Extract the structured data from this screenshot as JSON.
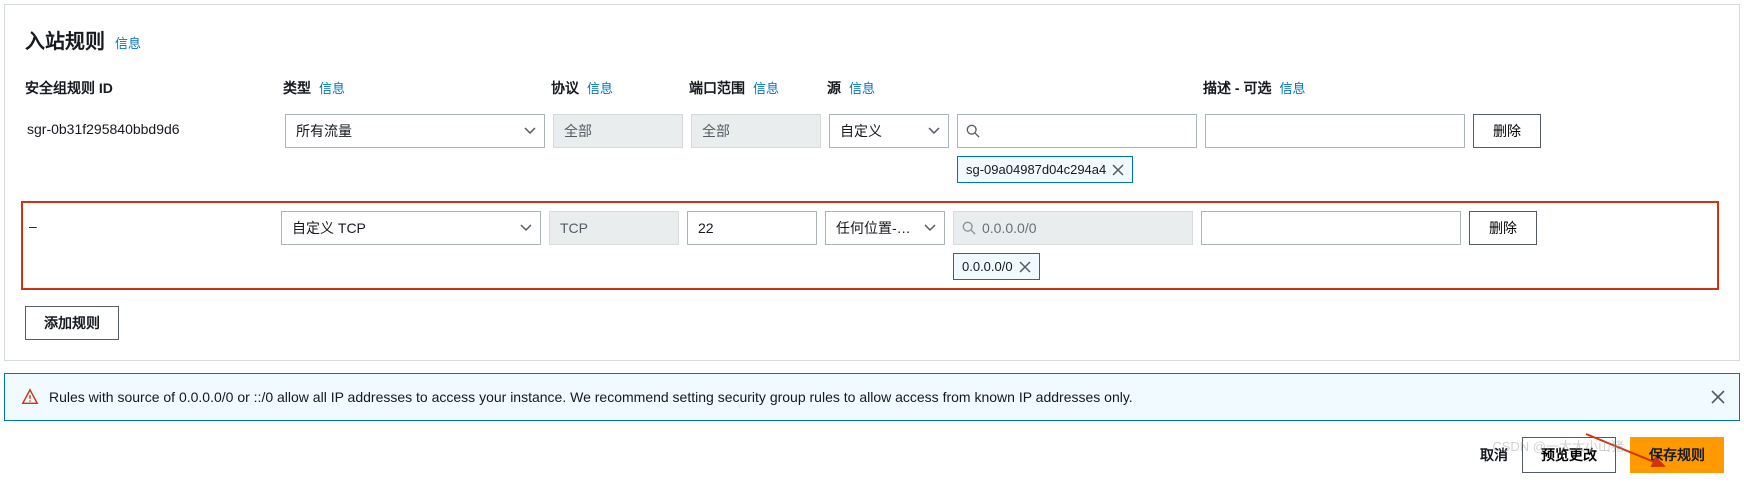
{
  "panel": {
    "title": "入站规则",
    "info_link": "信息"
  },
  "columns": {
    "rule_id": "安全组规则 ID",
    "type": "类型",
    "protocol": "协议",
    "port_range": "端口范围",
    "source": "源",
    "description": "描述 - 可选"
  },
  "info_link": "信息",
  "rules": [
    {
      "id": "sgr-0b31f295840bbd9d6",
      "type": "所有流量",
      "protocol": "全部",
      "port_range": "全部",
      "source_mode": "自定义",
      "source_tags": [
        "sg-09a04987d04c294a4"
      ],
      "source_search_placeholder": "",
      "description": "",
      "protocol_disabled": true,
      "port_disabled": true,
      "search_disabled": false
    },
    {
      "id": "–",
      "type": "自定义 TCP",
      "protocol": "TCP",
      "port_range": "22",
      "source_mode": "任何位置-…",
      "source_tags": [
        "0.0.0.0/0"
      ],
      "source_search_placeholder": "0.0.0.0/0",
      "description": "",
      "protocol_disabled": true,
      "port_disabled": false,
      "search_disabled": true
    }
  ],
  "buttons": {
    "delete": "删除",
    "add_rule": "添加规则",
    "cancel": "取消",
    "preview": "预览更改",
    "save": "保存规则"
  },
  "alert": {
    "text": "Rules with source of 0.0.0.0/0 or ::/0 allow all IP addresses to access your instance. We recommend setting security group rules to allow access from known IP addresses only."
  },
  "watermark": "CSDN @一大大小山猪"
}
